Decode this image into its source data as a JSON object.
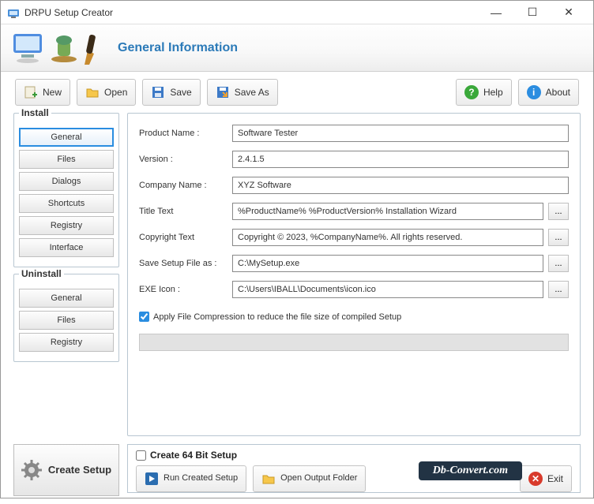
{
  "window": {
    "title": "DRPU Setup Creator"
  },
  "banner": {
    "title": "General Information"
  },
  "toolbar": {
    "new": "New",
    "open": "Open",
    "save": "Save",
    "saveas": "Save As",
    "help": "Help",
    "about": "About"
  },
  "nav": {
    "install_title": "Install",
    "install_items": [
      "General",
      "Files",
      "Dialogs",
      "Shortcuts",
      "Registry",
      "Interface"
    ],
    "uninstall_title": "Uninstall",
    "uninstall_items": [
      "General",
      "Files",
      "Registry"
    ]
  },
  "form": {
    "labels": {
      "product": "Product Name :",
      "version": "Version :",
      "company": "Company Name :",
      "titletext": "Title Text",
      "copyright": "Copyright Text",
      "savefile": "Save Setup File as :",
      "exeicon": "EXE Icon :"
    },
    "values": {
      "product": "Software Tester",
      "version": "2.4.1.5",
      "company": "XYZ Software",
      "titletext": "%ProductName% %ProductVersion% Installation Wizard",
      "copyright": "Copyright © 2023, %CompanyName%. All rights reserved.",
      "savefile": "C:\\MySetup.exe",
      "exeicon": "C:\\Users\\IBALL\\Documents\\icon.ico"
    },
    "compression_label": "Apply File Compression to reduce the file size of compiled Setup",
    "browse": "..."
  },
  "bottom": {
    "create": "Create Setup",
    "cb64": "Create 64 Bit Setup",
    "run": "Run Created Setup",
    "folder": "Open Output Folder",
    "exit": "Exit"
  },
  "watermark": "Db-Convert.com"
}
